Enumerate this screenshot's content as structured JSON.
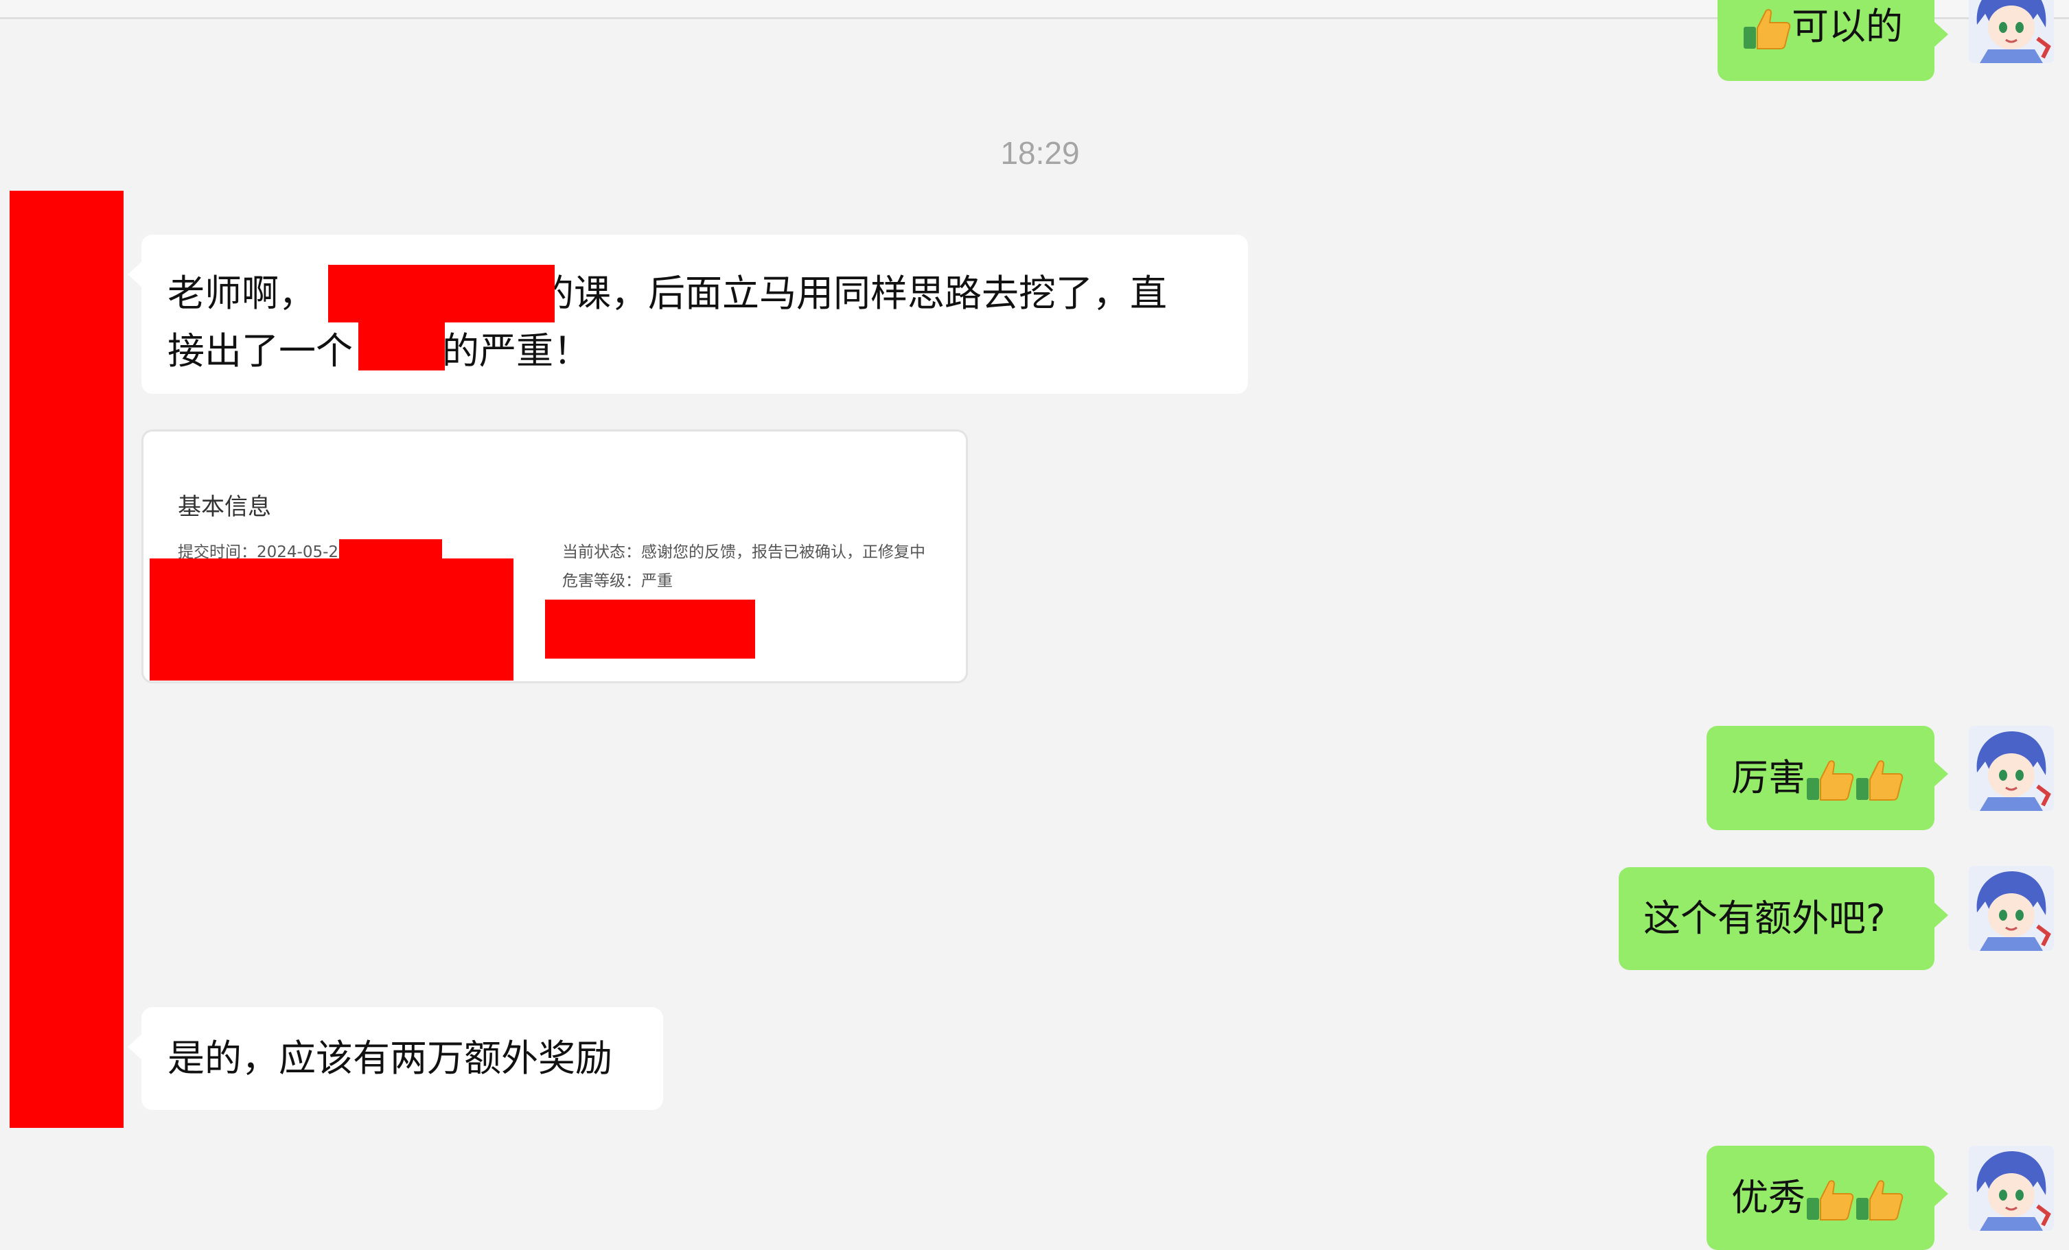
{
  "timestamp": "18:29",
  "messages": {
    "partial_top": {
      "text": "可以的"
    },
    "incoming_1": {
      "line1_a": "老师啊，",
      "line1_b": "的课，后面立马用同样思路去挖了，直",
      "line2_a": "接出了一个",
      "line2_b": "的严重！"
    },
    "report_card": {
      "title": "基本信息",
      "submit_time_label": "提交时间：2024-05-27",
      "status_label": "当前状态：感谢您的反馈，报告已被确认，正修复中",
      "level_label": "危害等级：严重"
    },
    "out_1": {
      "text": "厉害"
    },
    "out_2": {
      "text": "这个有额外吧?"
    },
    "incoming_2": {
      "text": "是的，应该有两万额外奖励"
    },
    "out_3": {
      "text": "优秀"
    }
  },
  "colors": {
    "background": "#f3f3f3",
    "outgoing_bubble": "#95ec69",
    "incoming_bubble": "#ffffff",
    "redaction": "#ff0000",
    "timestamp": "#a5a5a5"
  },
  "icons": [
    "thumbs-up-emoji",
    "avatar-anime-girl"
  ]
}
